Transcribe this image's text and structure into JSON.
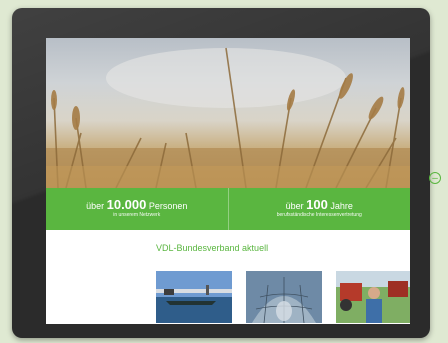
{
  "stats": [
    {
      "prefix": "über",
      "number": "10.000",
      "suffix": "Personen",
      "sub": "in unserem Netzwerk"
    },
    {
      "prefix": "über",
      "number": "100",
      "suffix": "Jahre",
      "sub": "berufsständische Interessenvertretung"
    }
  ],
  "section": {
    "title": "VDL-Bundesverband aktuell"
  },
  "thumbnails": [
    {
      "icon": "harbor-photo"
    },
    {
      "icon": "reichstag-dome-photo"
    },
    {
      "icon": "farmers-tractor-photo"
    }
  ],
  "colors": {
    "accent": "#5ab640",
    "bezel": "#2b2b2b",
    "page_background": "#dfe9d2"
  },
  "side_control": {
    "icon": "minus-circle-icon"
  }
}
